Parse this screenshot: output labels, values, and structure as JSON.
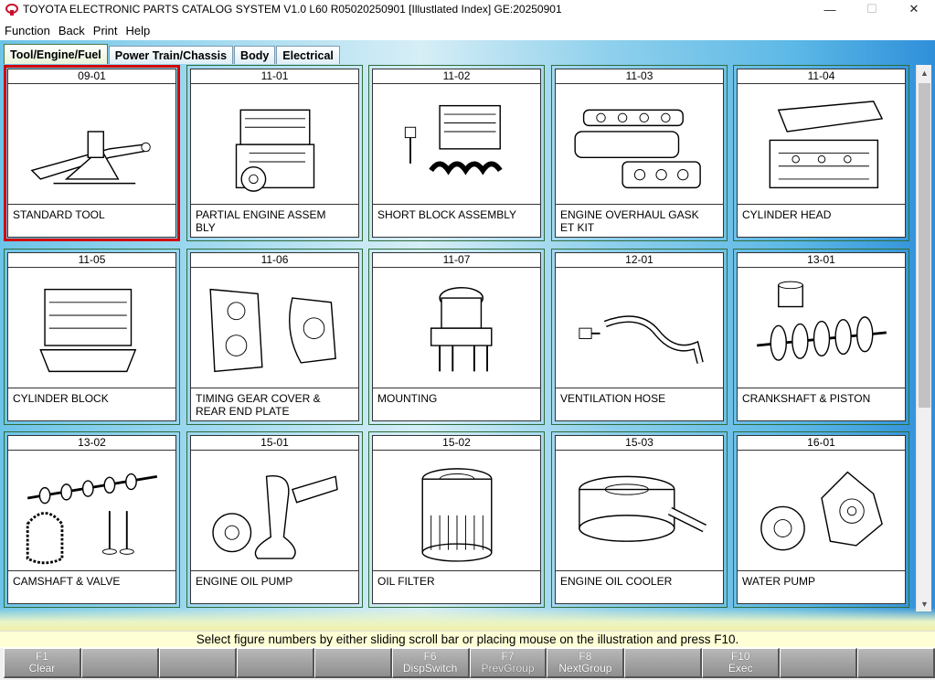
{
  "window": {
    "title": "TOYOTA ELECTRONIC PARTS CATALOG SYSTEM V1.0 L60 R05020250901 [Illustlated Index] GE:20250901",
    "minimize": "—",
    "maximize": "☐",
    "close": "✕"
  },
  "menu": [
    "Function",
    "Back",
    "Print",
    "Help"
  ],
  "tabs": [
    "Tool/Engine/Fuel",
    "Power Train/Chassis",
    "Body",
    "Electrical"
  ],
  "active_tab": "Tool/Engine/Fuel",
  "figures": [
    {
      "no": "09-01",
      "label": "STANDARD TOOL",
      "icon": "jack-icon",
      "selected": true
    },
    {
      "no": "11-01",
      "label": "PARTIAL ENGINE ASSEM\nBLY",
      "icon": "engine-assembly-icon"
    },
    {
      "no": "11-02",
      "label": "SHORT BLOCK ASSEMBLY",
      "icon": "short-block-icon"
    },
    {
      "no": "11-03",
      "label": "ENGINE OVERHAUL GASK\nET KIT",
      "icon": "gasket-kit-icon"
    },
    {
      "no": "11-04",
      "label": "CYLINDER HEAD",
      "icon": "cylinder-head-icon"
    },
    {
      "no": "11-05",
      "label": "CYLINDER BLOCK",
      "icon": "cylinder-block-icon"
    },
    {
      "no": "11-06",
      "label": "TIMING GEAR COVER &\nREAR END PLATE",
      "icon": "timing-cover-icon"
    },
    {
      "no": "11-07",
      "label": "MOUNTING",
      "icon": "engine-mount-icon"
    },
    {
      "no": "12-01",
      "label": "VENTILATION HOSE",
      "icon": "ventilation-hose-icon"
    },
    {
      "no": "13-01",
      "label": "CRANKSHAFT & PISTON",
      "icon": "crankshaft-icon"
    },
    {
      "no": "13-02",
      "label": "CAMSHAFT & VALVE",
      "icon": "camshaft-icon"
    },
    {
      "no": "15-01",
      "label": "ENGINE OIL PUMP",
      "icon": "oil-pump-icon"
    },
    {
      "no": "15-02",
      "label": "OIL FILTER",
      "icon": "oil-filter-icon"
    },
    {
      "no": "15-03",
      "label": "ENGINE OIL COOLER",
      "icon": "oil-cooler-icon"
    },
    {
      "no": "16-01",
      "label": "WATER PUMP",
      "icon": "water-pump-icon"
    }
  ],
  "status_text": "Select figure numbers by either sliding scroll bar or placing mouse on the illustration and press F10.",
  "function_keys": [
    {
      "key": "F1",
      "label": "Clear"
    },
    {
      "key": "",
      "label": ""
    },
    {
      "key": "",
      "label": ""
    },
    {
      "key": "",
      "label": ""
    },
    {
      "key": "",
      "label": ""
    },
    {
      "key": "F6",
      "label": "DispSwitch"
    },
    {
      "key": "F7",
      "label": "PrevGroup"
    },
    {
      "key": "F8",
      "label": "NextGroup"
    },
    {
      "key": "",
      "label": ""
    },
    {
      "key": "F10",
      "label": "Exec"
    },
    {
      "key": "",
      "label": ""
    },
    {
      "key": "",
      "label": ""
    }
  ],
  "colors": {
    "selected_border": "#d40000",
    "status_bg": "#ffffd6",
    "accent_blue": "#2f8fd9"
  }
}
